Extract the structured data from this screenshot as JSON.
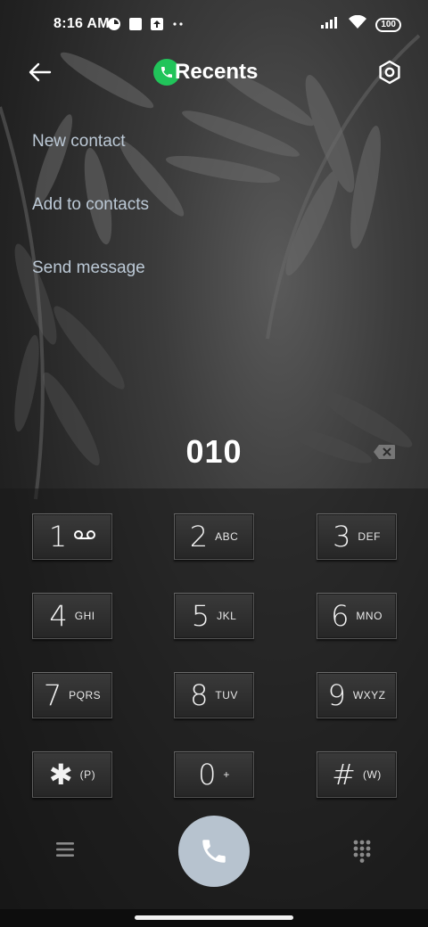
{
  "status_bar": {
    "time": "8:16 AM",
    "battery": "100",
    "icons_left": [
      "notification-app-icon",
      "square-icon",
      "upload-icon",
      "more-dots-icon"
    ],
    "icons_right": [
      "signal-icon",
      "wifi-icon",
      "battery-icon"
    ]
  },
  "header": {
    "title": "Recents",
    "back_icon": "arrow-left-icon",
    "settings_icon": "settings-hexagon-icon"
  },
  "menu": {
    "items": [
      {
        "label": "New contact"
      },
      {
        "label": "Add to contacts"
      },
      {
        "label": "Send message"
      }
    ]
  },
  "dial": {
    "number": "010"
  },
  "keypad": {
    "keys": [
      {
        "digit": "1",
        "letters": ""
      },
      {
        "digit": "2",
        "letters": "ABC"
      },
      {
        "digit": "3",
        "letters": "DEF"
      },
      {
        "digit": "4",
        "letters": "GHI"
      },
      {
        "digit": "5",
        "letters": "JKL"
      },
      {
        "digit": "6",
        "letters": "MNO"
      },
      {
        "digit": "7",
        "letters": "PQRS"
      },
      {
        "digit": "8",
        "letters": "TUV"
      },
      {
        "digit": "9",
        "letters": "WXYZ"
      },
      {
        "digit": "✱",
        "letters": "(P)"
      },
      {
        "digit": "0",
        "letters": "+"
      },
      {
        "digit": "#",
        "letters": "(W)"
      }
    ]
  },
  "colors": {
    "accent_green": "#21c45a",
    "menu_text": "#bcc9d6",
    "call_button": "#b7c3cf"
  }
}
